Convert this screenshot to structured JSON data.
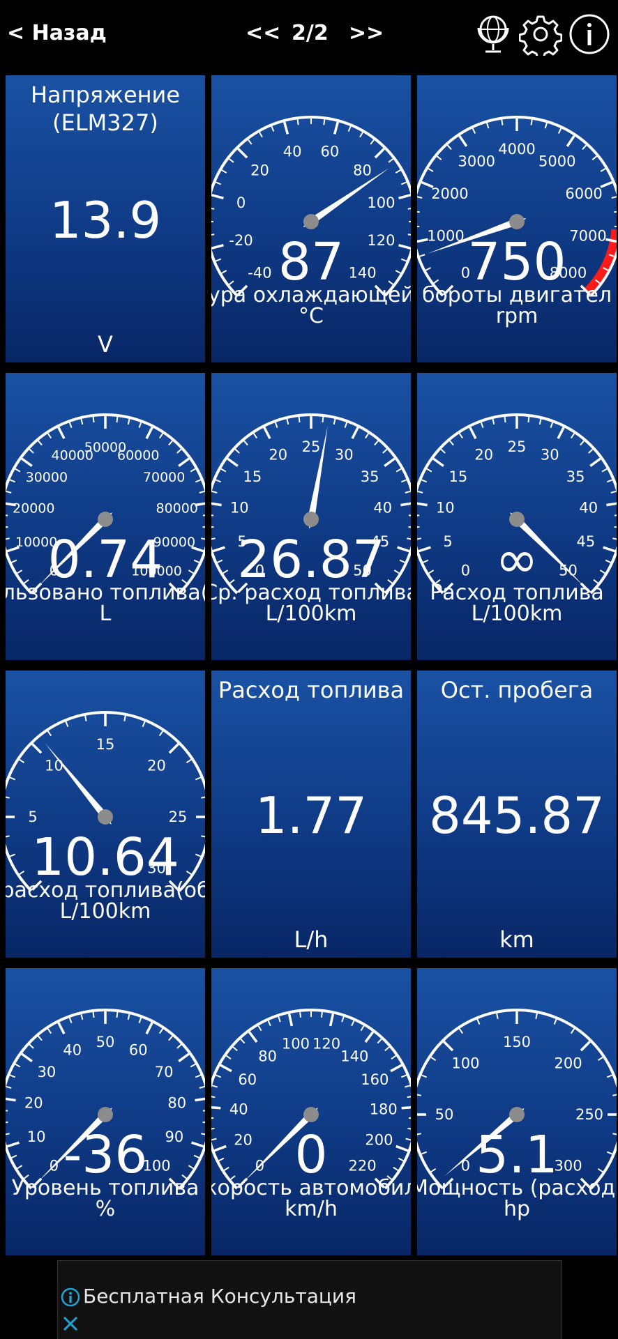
{
  "topbar": {
    "back_label": "< Назад",
    "prev_label": "<<",
    "page_indicator": "2/2",
    "next_label": ">>"
  },
  "gauges": [
    {
      "type": "digital",
      "title": "Напряжение\n(ELM327)",
      "value": "13.9",
      "unit": "V"
    },
    {
      "type": "analog",
      "name": "ура охлаждающей",
      "value": "87",
      "unit": "°C",
      "ticks": [
        "-40",
        "-20",
        "0",
        "20",
        "40",
        "60",
        "80",
        "100",
        "120",
        "140"
      ],
      "reading": 87,
      "min": -40,
      "max": 140,
      "redzone": null
    },
    {
      "type": "analog",
      "name": "бороты двигател",
      "value": "750",
      "unit": "rpm",
      "ticks": [
        "0",
        "1000",
        "2000",
        "3000",
        "4000",
        "5000",
        "6000",
        "7000",
        "8000"
      ],
      "reading": 750,
      "min": 0,
      "max": 8000,
      "redzone": [
        6800,
        8000
      ]
    },
    {
      "type": "analog",
      "name": "льзовано топлива(",
      "value": "0.74",
      "unit": "L",
      "ticks": [
        "0",
        "10000",
        "20000",
        "30000",
        "40000",
        "50000",
        "60000",
        "70000",
        "80000",
        "90000",
        "100000"
      ],
      "reading": 0.74,
      "min": 0,
      "max": 100000,
      "redzone": null
    },
    {
      "type": "analog",
      "name": "Ср. расход топлива",
      "value": "26.87",
      "unit": "L/100km",
      "ticks": [
        "0",
        "5",
        "10",
        "15",
        "20",
        "25",
        "30",
        "35",
        "40",
        "45",
        "50"
      ],
      "reading": 26.87,
      "min": 0,
      "max": 50,
      "redzone": null
    },
    {
      "type": "analog",
      "name": "Расход топлива",
      "value": "∞",
      "unit": "L/100km",
      "ticks": [
        "0",
        "5",
        "10",
        "15",
        "20",
        "25",
        "30",
        "35",
        "40",
        "45",
        "50"
      ],
      "reading": 50,
      "min": 0,
      "max": 50,
      "redzone": null
    },
    {
      "type": "analog",
      "name": "расход топлива(об",
      "value": "10.64",
      "unit": "L/100km",
      "ticks": [
        "5",
        "10",
        "15",
        "20",
        "25",
        "30"
      ],
      "reading": 10.64,
      "min": 0,
      "max": 30,
      "redzone": null,
      "tick_start": 1
    },
    {
      "type": "digital",
      "title": "Расход топлива",
      "value": "1.77",
      "unit": "L/h"
    },
    {
      "type": "digital",
      "title": "Ост. пробега",
      "value": "845.87",
      "unit": "km"
    },
    {
      "type": "analog",
      "name": "Уровень топлива",
      "value": "-36",
      "unit": "%",
      "ticks": [
        "0",
        "10",
        "20",
        "30",
        "40",
        "50",
        "60",
        "70",
        "80",
        "90",
        "100"
      ],
      "reading": 0,
      "min": 0,
      "max": 100,
      "redzone": null
    },
    {
      "type": "analog",
      "name": "корость автомобил",
      "value": "0",
      "unit": "km/h",
      "ticks": [
        "0",
        "20",
        "40",
        "60",
        "80",
        "100",
        "120",
        "140",
        "160",
        "180",
        "200",
        "220"
      ],
      "reading": 0,
      "min": 0,
      "max": 220,
      "redzone": null
    },
    {
      "type": "analog",
      "name": "Мощность (расход)",
      "value": "5.1",
      "unit": "hp",
      "ticks": [
        "0",
        "50",
        "100",
        "150",
        "200",
        "250",
        "300"
      ],
      "reading": 5.1,
      "min": 0,
      "max": 300,
      "redzone": null
    }
  ],
  "ad": {
    "text": "Бесплатная Консультация"
  },
  "icons": {
    "globe": "globe-icon",
    "settings": "gear-icon",
    "info": "info-icon",
    "ad_info": "info-icon",
    "ad_close": "close-icon"
  },
  "colors": {
    "background": "#000000",
    "tile_top": "#1a51a3",
    "tile_bottom": "#082665",
    "redzone": "#ff1a1a",
    "needle_hub": "#8c8c8c"
  }
}
